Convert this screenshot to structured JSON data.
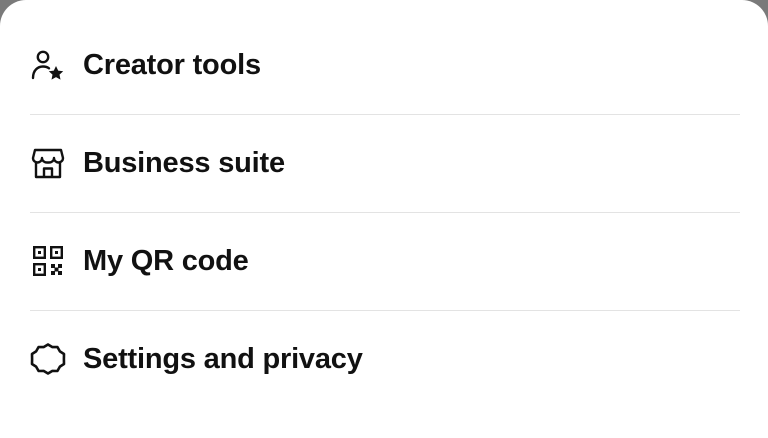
{
  "menu": {
    "items": [
      {
        "label": "Creator tools",
        "icon": "person-star-icon"
      },
      {
        "label": "Business suite",
        "icon": "storefront-icon"
      },
      {
        "label": "My QR code",
        "icon": "qr-code-icon"
      },
      {
        "label": "Settings and privacy",
        "icon": "gear-icon"
      }
    ]
  },
  "colors": {
    "sheet_background": "#ffffff",
    "text": "#111111",
    "divider": "#e3e3e3",
    "backdrop": "#7a7a7a"
  }
}
